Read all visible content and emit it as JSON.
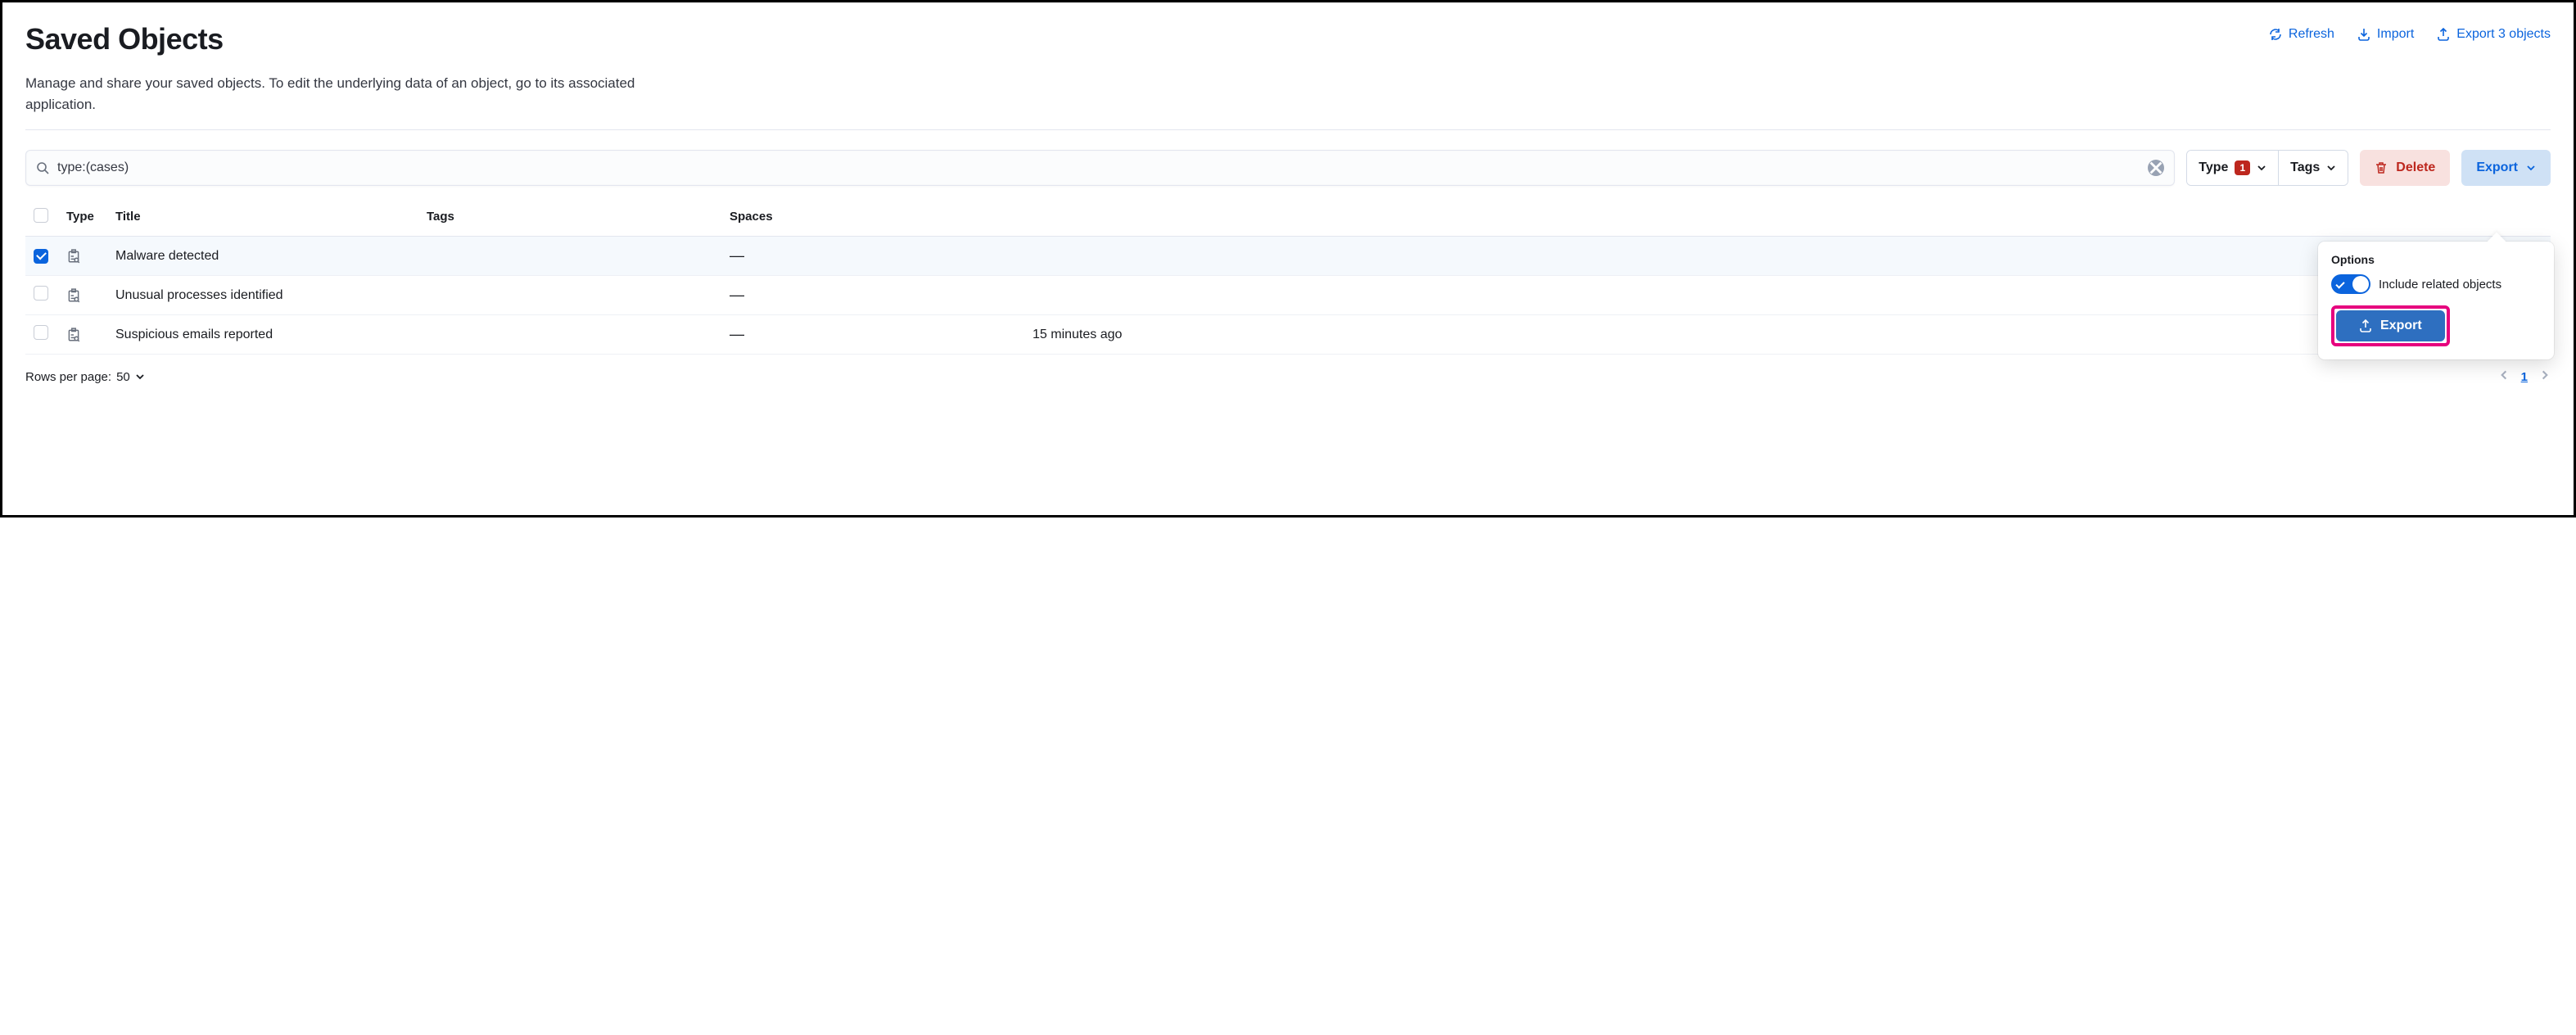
{
  "header": {
    "title": "Saved Objects",
    "subtitle": "Manage and share your saved objects. To edit the underlying data of an object, go to its associated application.",
    "actions": {
      "refresh": "Refresh",
      "import": "Import",
      "export": "Export 3 objects"
    }
  },
  "toolbar": {
    "search_value": "type:(cases)",
    "type_filter_label": "Type",
    "type_filter_count": "1",
    "tags_filter_label": "Tags",
    "delete_label": "Delete",
    "export_dropdown_label": "Export"
  },
  "table": {
    "columns": {
      "type": "Type",
      "title": "Title",
      "tags": "Tags",
      "spaces": "Spaces"
    },
    "rows": [
      {
        "selected": true,
        "title": "Malware detected",
        "tags": "",
        "spaces": "—",
        "last": ""
      },
      {
        "selected": false,
        "title": "Unusual processes identified",
        "tags": "",
        "spaces": "—",
        "last": ""
      },
      {
        "selected": false,
        "title": "Suspicious emails reported",
        "tags": "",
        "spaces": "—",
        "last": "15 minutes ago"
      }
    ]
  },
  "footer": {
    "rows_per_page_label": "Rows per page:",
    "rows_per_page_value": "50",
    "current_page": "1"
  },
  "popover": {
    "title": "Options",
    "include_related_label": "Include related objects",
    "include_related_on": true,
    "export_button": "Export"
  }
}
